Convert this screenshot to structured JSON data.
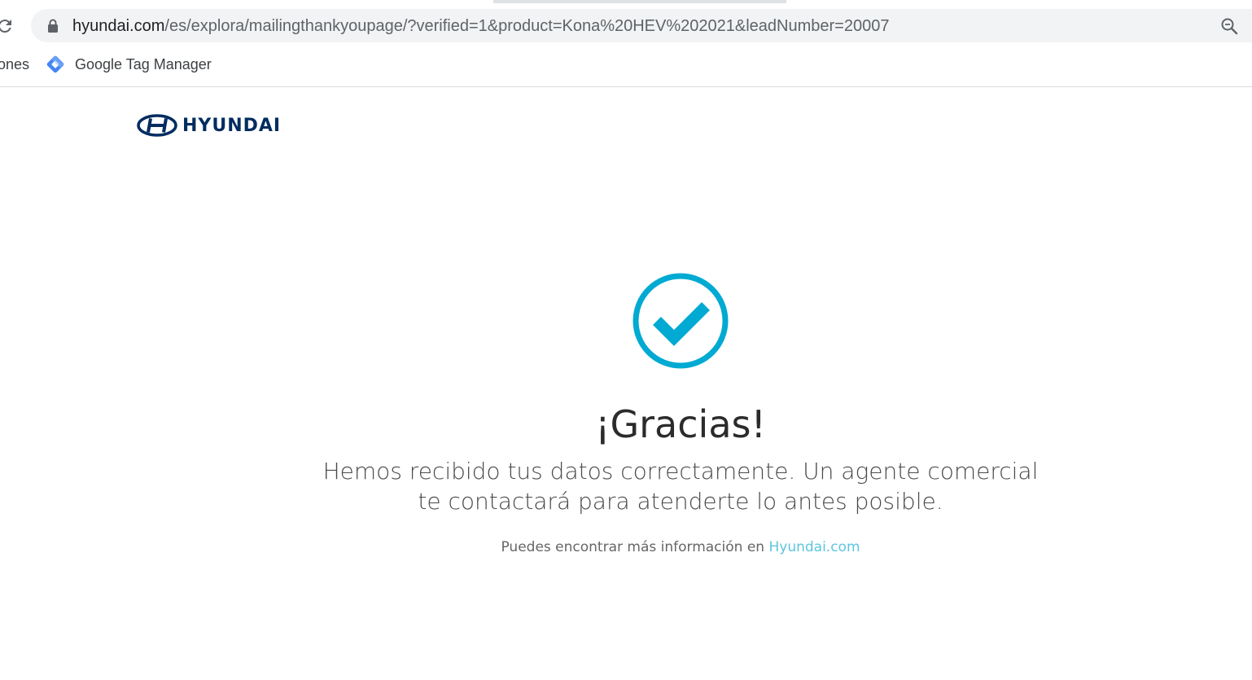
{
  "browser": {
    "url_host": "hyundai.com",
    "url_path": "/es/explora/mailingthankyoupage/?verified=1&product=Kona%20HEV%202021&leadNumber=20007",
    "bookmarks": [
      {
        "label": "ones",
        "icon": "folder-icon"
      },
      {
        "label": "Google Tag Manager",
        "icon": "google-tag-manager-icon"
      }
    ]
  },
  "header": {
    "brand": "HYUNDAI"
  },
  "main": {
    "title": "¡Gracias!",
    "message": "Hemos recibido tus datos correctamente. Un agente comercial te contactará para atenderte lo antes posible.",
    "more_info_prefix": "Puedes encontrar más información en",
    "more_info_link": "Hyundai.com"
  },
  "colors": {
    "accent": "#00aad2",
    "link": "#5ec5de",
    "brand": "#002c5f"
  }
}
